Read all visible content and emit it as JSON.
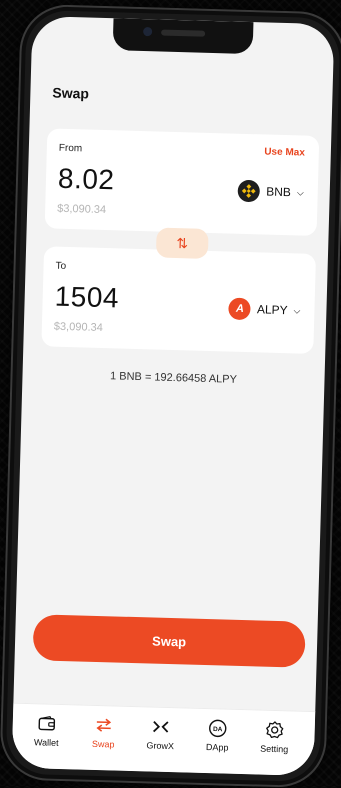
{
  "page": {
    "title": "Swap"
  },
  "from": {
    "label": "From",
    "amount": "8.02",
    "usd": "$3,090.34",
    "use_max": "Use Max",
    "token": "BNB",
    "token_icon": "bnb-coin-icon"
  },
  "to": {
    "label": "To",
    "amount": "1504",
    "usd": "$3,090.34",
    "token": "ALPY",
    "token_icon": "alpy-coin-icon",
    "token_letter": "A"
  },
  "rate": "1 BNB = 192.66458 ALPY",
  "swap_button": "Swap",
  "tabs": [
    {
      "label": "Wallet",
      "icon": "wallet-icon"
    },
    {
      "label": "Swap",
      "icon": "swap-icon",
      "active": true
    },
    {
      "label": "GrowX",
      "icon": "growx-icon"
    },
    {
      "label": "DApp",
      "icon": "dapp-icon",
      "badge": "DA"
    },
    {
      "label": "Setting",
      "icon": "gear-icon"
    }
  ],
  "colors": {
    "accent": "#ec4a24",
    "accent_soft": "#fbe6d4",
    "background": "#f3f3f3",
    "bnb": "#f0b90b"
  }
}
